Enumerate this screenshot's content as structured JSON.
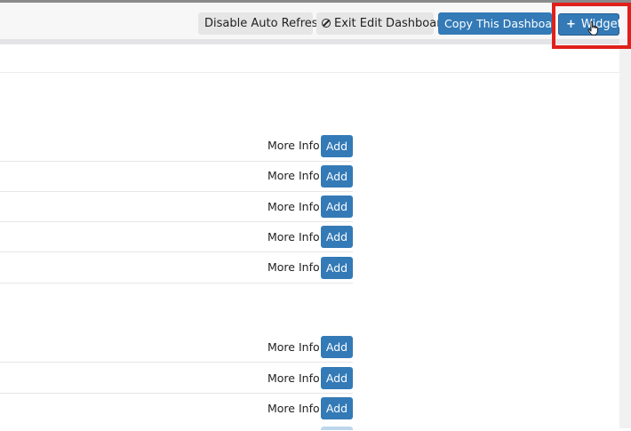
{
  "toolbar": {
    "disable_auto_refresh": "Disable Auto Refresh",
    "exit_edit_dashboard": "Exit Edit Dashboard",
    "copy_this_dashboard": "Copy This Dashboard",
    "widget_plus": "+",
    "widget_label": "Widget"
  },
  "colors": {
    "primary": "#337ab7",
    "highlight": "#e0201b"
  },
  "sections": [
    {
      "rows": [
        {
          "more_info": "More Info",
          "add": "Add"
        },
        {
          "more_info": "More Info",
          "add": "Add"
        },
        {
          "more_info": "More Info",
          "add": "Add"
        },
        {
          "more_info": "More Info",
          "add": "Add"
        },
        {
          "more_info": "More Info",
          "add": "Add"
        }
      ]
    },
    {
      "rows": [
        {
          "more_info": "More Info",
          "add": "Add"
        },
        {
          "more_info": "More Info",
          "add": "Add"
        },
        {
          "more_info": "More Info",
          "add": "Add"
        }
      ]
    }
  ]
}
